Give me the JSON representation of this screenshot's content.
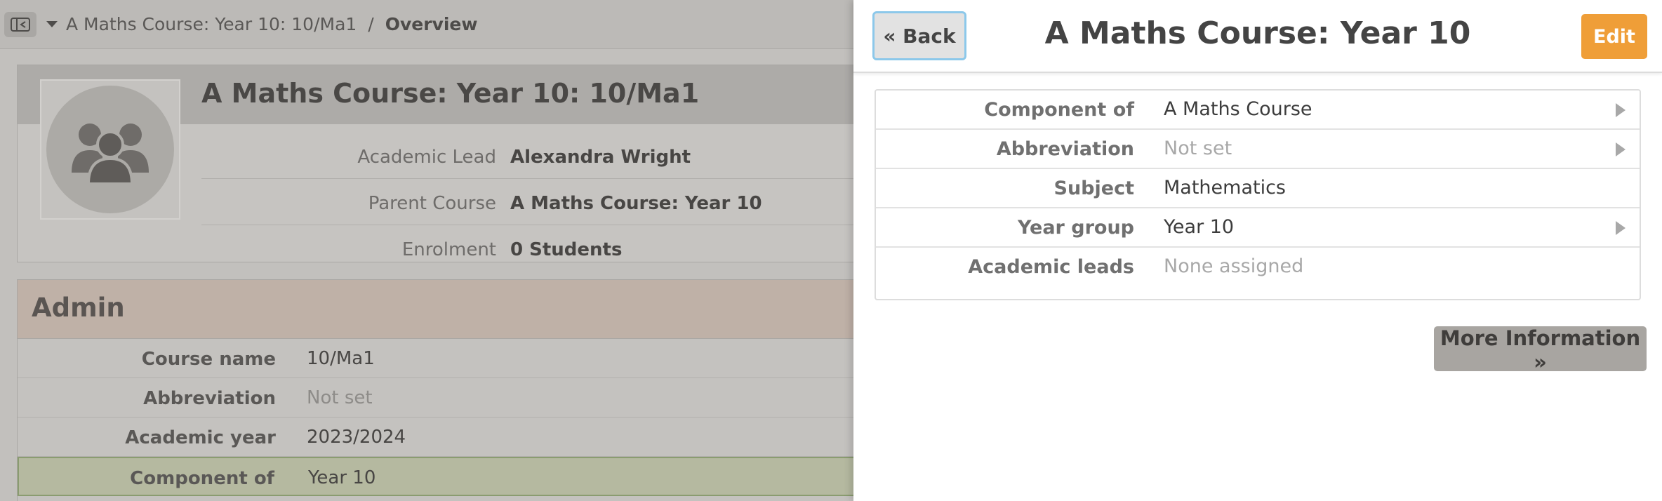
{
  "background": {
    "breadcrumb": {
      "parent": "A Maths Course: Year 10: 10/Ma1",
      "separator": "/",
      "current": "Overview"
    },
    "course_card": {
      "title": "A Maths Course: Year 10: 10/Ma1",
      "rows": [
        {
          "label": "Academic Lead",
          "value": "Alexandra Wright"
        },
        {
          "label": "Parent Course",
          "value": "A Maths Course: Year 10"
        },
        {
          "label": "Enrolment",
          "value": "0 Students"
        }
      ]
    },
    "admin": {
      "title": "Admin",
      "rows": [
        {
          "label": "Course name",
          "value": "10/Ma1"
        },
        {
          "label": "Abbreviation",
          "value": "Not set"
        },
        {
          "label": "Academic year",
          "value": "2023/2024"
        },
        {
          "label": "Component of",
          "value": "Year 10"
        }
      ]
    }
  },
  "panel": {
    "back_label": "« Back",
    "title": "A Maths Course: Year 10",
    "edit_label": "Edit",
    "rows": [
      {
        "label": "Component of",
        "value": "A Maths Course"
      },
      {
        "label": "Abbreviation",
        "value": "Not set"
      },
      {
        "label": "Subject",
        "value": "Mathematics"
      },
      {
        "label": "Year group",
        "value": "Year 10"
      },
      {
        "label": "Academic leads",
        "value": "None assigned"
      }
    ],
    "more_label": "More Information »"
  },
  "colors": {
    "accent_orange": "#ef9e38",
    "back_focus_ring": "#8cc8ea",
    "muted_text": "#a8a8a8"
  }
}
